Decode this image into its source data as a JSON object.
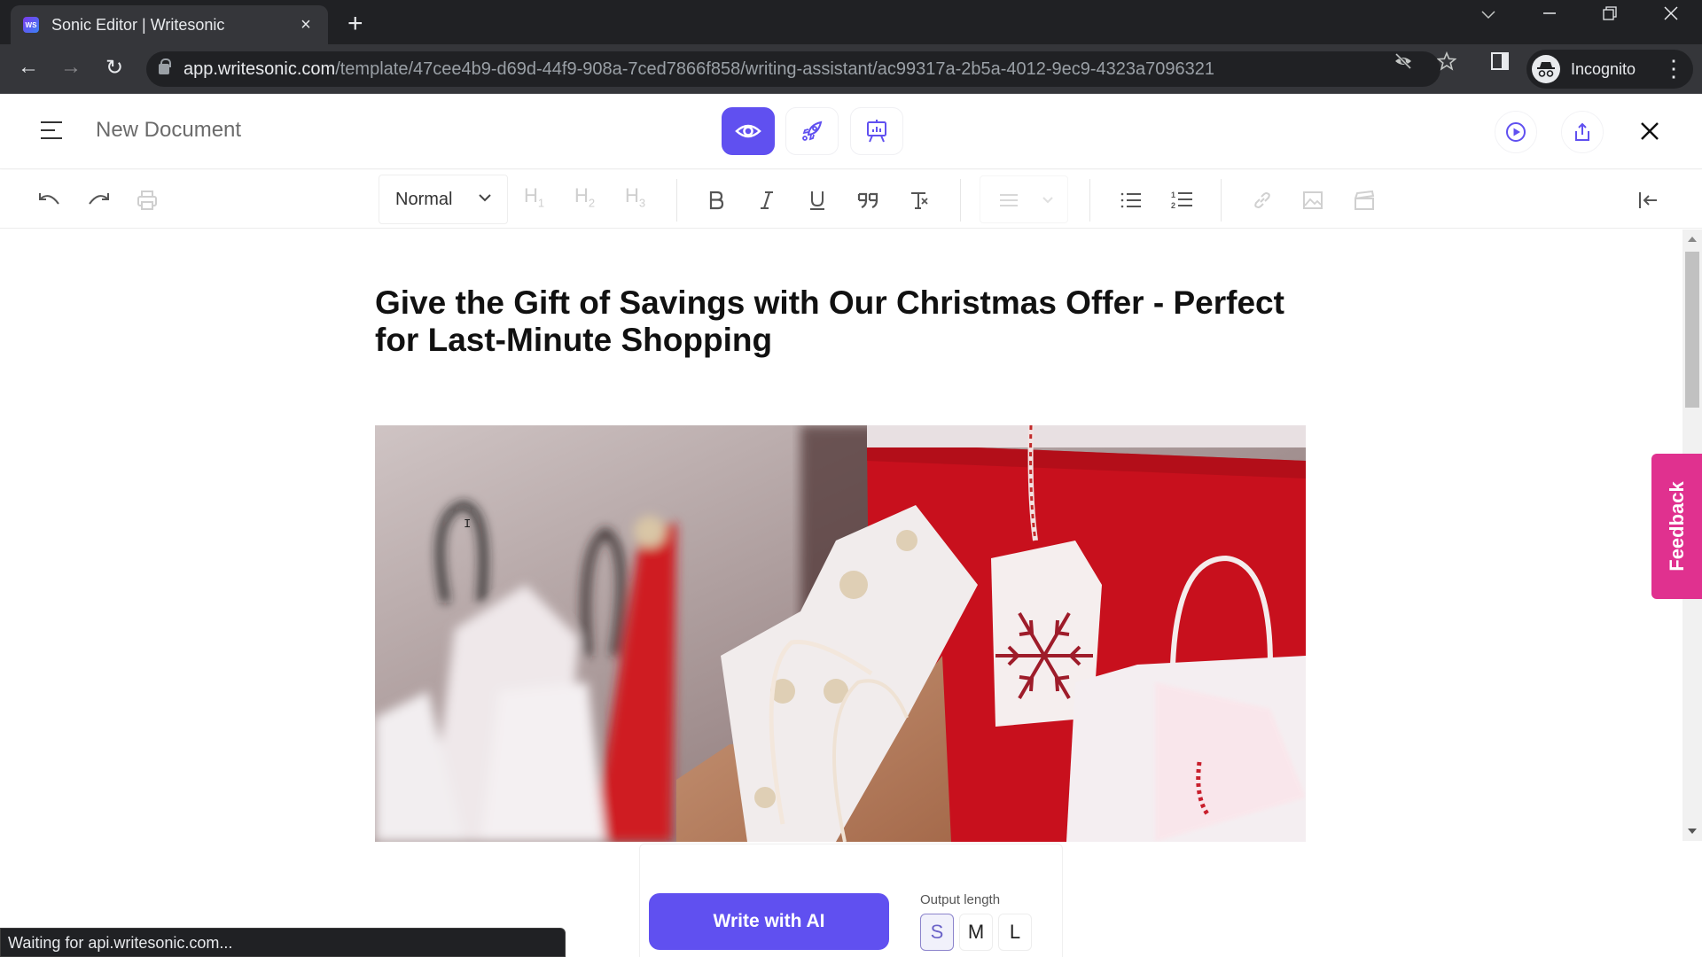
{
  "browser": {
    "tab_title": "Sonic Editor | Writesonic",
    "favicon_text": "WS",
    "url_host": "app.writesonic.com",
    "url_path": "/template/47cee4b9-d69d-44f9-908a-7ced7866f858/writing-assistant/ac99317a-2b5a-4012-9ec9-4323a7096321",
    "profile_label": "Incognito",
    "icons": {
      "new_tab": "+",
      "tab_close": "×",
      "back": "←",
      "forward": "→",
      "reload": "↻",
      "tab_search": "⌄",
      "minimize": "—",
      "restore": "❐",
      "close": "✕",
      "menu": "⋮",
      "incognito": "🕶"
    }
  },
  "app": {
    "document_title": "New Document",
    "modes": [
      {
        "name": "preview",
        "icon": "eye-icon",
        "active": true
      },
      {
        "name": "boost",
        "icon": "rocket-icon",
        "active": false
      },
      {
        "name": "present",
        "icon": "presentation-icon",
        "active": false
      }
    ],
    "accent_color": "#6050f0",
    "feedback_color": "#e0318f"
  },
  "format_toolbar": {
    "text_style": "Normal",
    "headings": [
      "H1",
      "H2",
      "H3"
    ],
    "heading_letters": [
      "H",
      "H",
      "H"
    ],
    "heading_nums": [
      "1",
      "2",
      "3"
    ]
  },
  "document": {
    "heading": "Give the Gift of Savings with Our Christmas Offer - Perfect for Last-Minute Shopping",
    "image_alt": "Christmas shopping bags with red, white and kraft paper bags and a snowflake gift tag"
  },
  "feedback": {
    "label": "Feedback"
  },
  "ai_panel": {
    "write_button": "Write with AI",
    "output_length_label": "Output length",
    "lengths": [
      "S",
      "M",
      "L"
    ],
    "selected_length": "S"
  },
  "status": {
    "text": "Waiting for api.writesonic.com..."
  }
}
